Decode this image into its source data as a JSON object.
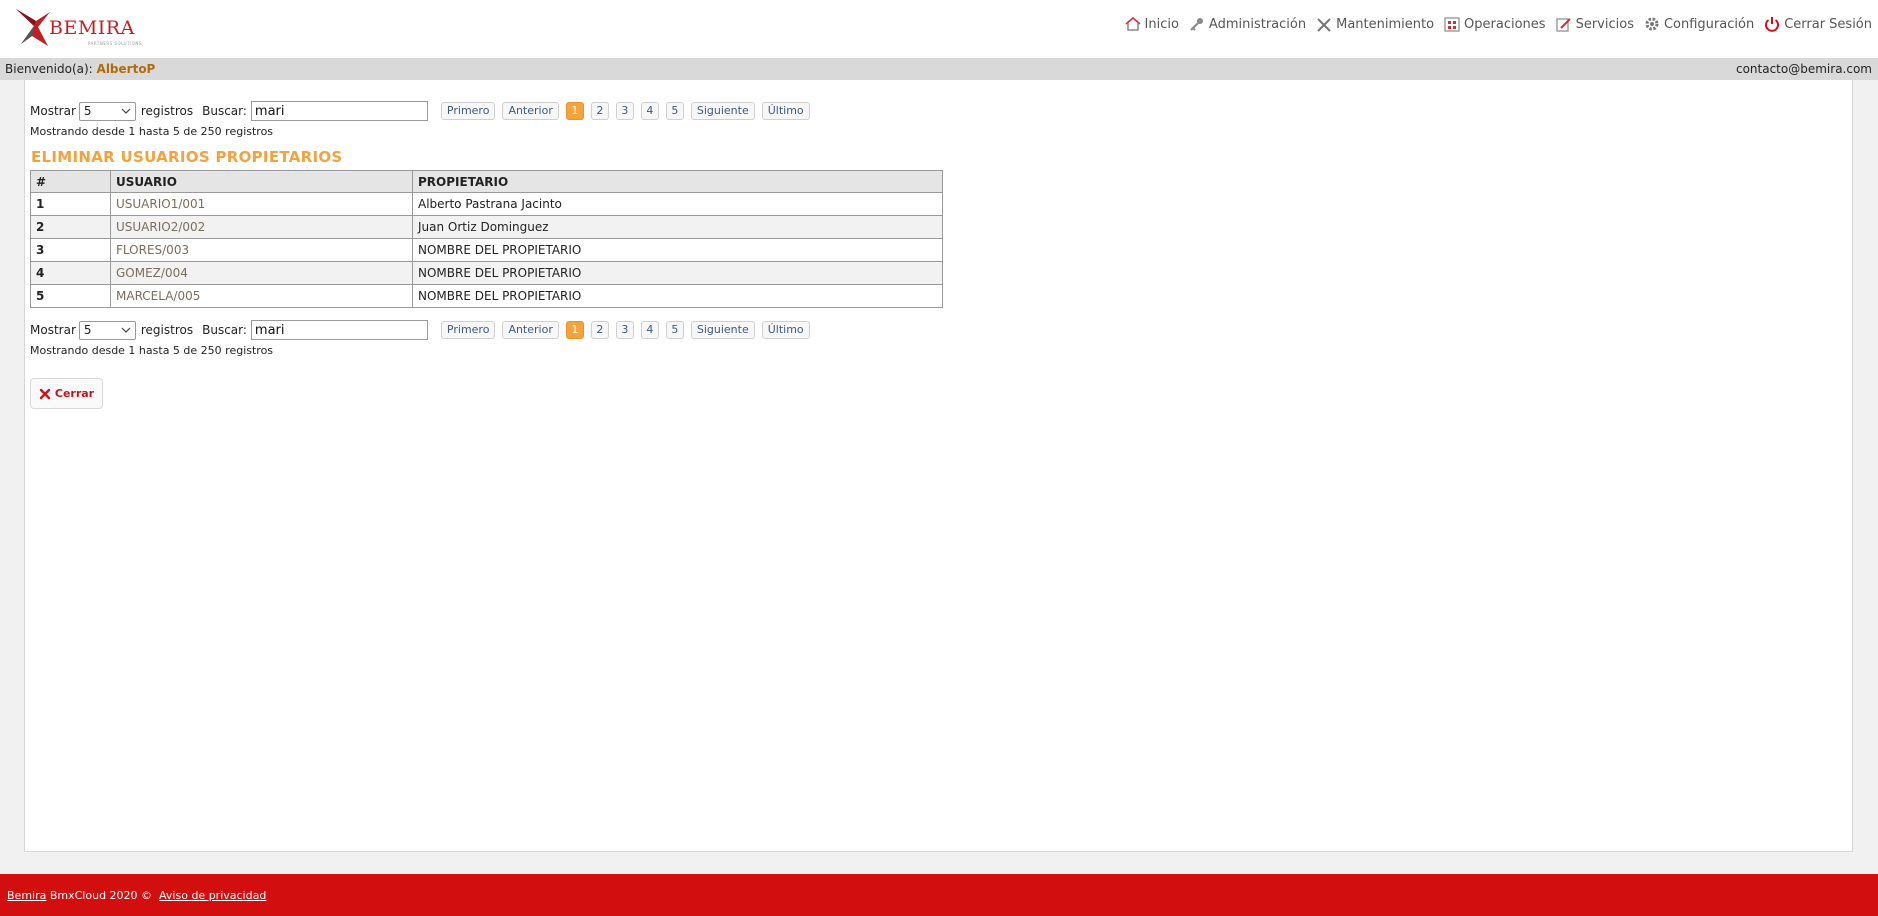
{
  "brand": {
    "name": "BEMIRA",
    "tagline": "PARTNERS SOLUTIONS",
    "color": "#c21f24"
  },
  "nav": [
    {
      "label": "Inicio",
      "icon": "home-icon"
    },
    {
      "label": "Administración",
      "icon": "key-icon"
    },
    {
      "label": "Mantenimiento",
      "icon": "tools-icon"
    },
    {
      "label": "Operaciones",
      "icon": "grid-icon"
    },
    {
      "label": "Servicios",
      "icon": "edit-icon"
    },
    {
      "label": "Configuración",
      "icon": "gear-icon"
    },
    {
      "label": "Cerrar Sesión",
      "icon": "power-icon"
    }
  ],
  "welcome": {
    "prefix": "Bienvenido(a):",
    "user": "AlbertoP",
    "contact": "contacto@bemira.com"
  },
  "controls": {
    "show_label": "Mostrar",
    "show_value": "5",
    "records_label": "registros",
    "search_label": "Buscar:",
    "search_value": "mari",
    "info": "Mostrando desde 1 hasta 5 de 250 registros",
    "pager": {
      "first": "Primero",
      "prev": "Anterior",
      "pages": [
        "1",
        "2",
        "3",
        "4",
        "5"
      ],
      "active_page": "1",
      "next": "Siguiente",
      "last": "Último"
    }
  },
  "title": "ELIMINAR USUARIOS PROPIETARIOS",
  "table": {
    "headers": [
      "#",
      "USUARIO",
      "PROPIETARIO"
    ],
    "rows": [
      {
        "num": "1",
        "usuario": "USUARIO1/001",
        "propietario": "Alberto Pastrana Jacinto"
      },
      {
        "num": "2",
        "usuario": "USUARIO2/002",
        "propietario": "Juan Ortiz Dominguez"
      },
      {
        "num": "3",
        "usuario": "FLORES/003",
        "propietario": "NOMBRE DEL PROPIETARIO"
      },
      {
        "num": "4",
        "usuario": "GOMEZ/004",
        "propietario": "NOMBRE DEL PROPIETARIO"
      },
      {
        "num": "5",
        "usuario": "MARCELA/005",
        "propietario": "NOMBRE DEL PROPIETARIO"
      }
    ]
  },
  "close_button": "Cerrar",
  "footer": {
    "brand_link": "Bemira",
    "text": "BmxCloud 2020 ©",
    "privacy_link": "Aviso de privacidad"
  },
  "colors": {
    "accent": "#f3a23e",
    "footer": "#d30e0e",
    "active_page": "#f6a33a",
    "danger": "#c0161a"
  }
}
